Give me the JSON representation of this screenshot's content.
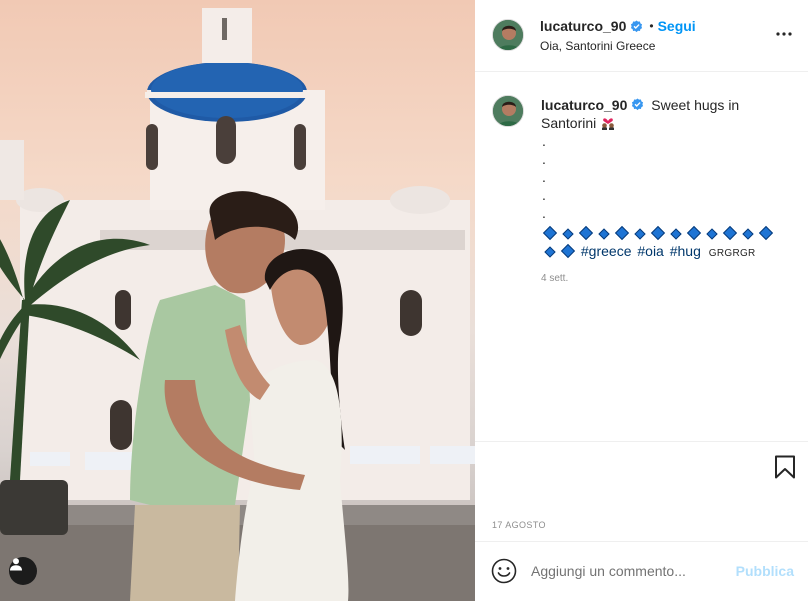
{
  "post": {
    "username": "lucaturco_90",
    "follow_label": "Segui",
    "separator": "•",
    "location": "Oia, Santorini Greece",
    "caption_text": "Sweet hugs in Santorini",
    "caption_dots": [
      ".",
      ".",
      ".",
      ".",
      "."
    ],
    "hashtags": [
      "#greece",
      "#oia",
      "#hug"
    ],
    "caption_tail": "GRGRGR",
    "time_ago": "4 sett.",
    "date": "17 AGOSTO"
  },
  "comment": {
    "placeholder": "Aggiungi un commento...",
    "publish_label": "Pubblica"
  },
  "colors": {
    "accent": "#0095f6",
    "publish_disabled": "#b2dffc",
    "hashtag": "#00376b",
    "muted": "#8e8e8e",
    "diamond": "#1e74d4"
  },
  "icons": {
    "verified": "verified-badge-icon",
    "more": "more-options-icon",
    "bookmark": "bookmark-icon",
    "emoji": "emoji-smiley-icon",
    "user_tag": "user-tag-icon",
    "hug_emoji": "couple-with-heart-icon"
  }
}
